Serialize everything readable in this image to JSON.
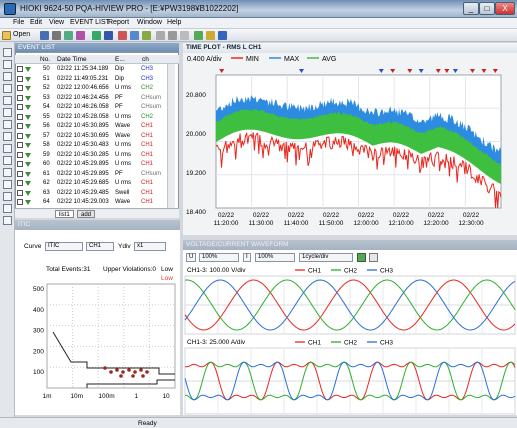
{
  "window": {
    "title": "HIOKI 9624-50 PQA-HIVIEW PRO - [E:¥PW3198¥B1022202]",
    "minimize": "_",
    "maximize": "□",
    "close": "X"
  },
  "menu": [
    "File",
    "Edit",
    "View",
    "EVENT LIST",
    "Report",
    "Window",
    "Help"
  ],
  "toolbar": {
    "open_label": "Open"
  },
  "event_list": {
    "title": "EVENT LIST",
    "columns": [
      "No.",
      "Date Time",
      "E...",
      "ch"
    ],
    "rows": [
      {
        "no": "50",
        "time": "02/22 11:25:34.189",
        "event": "Dip",
        "ch": "CH3",
        "ch_color": "#2030c0"
      },
      {
        "no": "51",
        "time": "02/22 11:49:05.231",
        "event": "Dip",
        "ch": "CH3",
        "ch_color": "#2030c0"
      },
      {
        "no": "52",
        "time": "02/22 12:00:46.656",
        "event": "U rms",
        "ch": "CH2",
        "ch_color": "#2a8f2a"
      },
      {
        "no": "53",
        "time": "02/22 10:46:24.456",
        "event": "PF",
        "ch": "CHsum",
        "ch_color": "#707070"
      },
      {
        "no": "54",
        "time": "02/22 10:46:26.058",
        "event": "PF",
        "ch": "CHsum",
        "ch_color": "#707070"
      },
      {
        "no": "55",
        "time": "02/22 10:45:28.058",
        "event": "U rms",
        "ch": "CH2",
        "ch_color": "#2a8f2a"
      },
      {
        "no": "56",
        "time": "02/22 10:45:30.895",
        "event": "Wave",
        "ch": "CH1",
        "ch_color": "#d02020"
      },
      {
        "no": "57",
        "time": "02/22 10:45:30.695",
        "event": "Wave",
        "ch": "CH1",
        "ch_color": "#d02020"
      },
      {
        "no": "58",
        "time": "02/22 10:45:30.483",
        "event": "U rms",
        "ch": "CH1",
        "ch_color": "#d02020"
      },
      {
        "no": "59",
        "time": "02/22 10:45:30.285",
        "event": "U rms",
        "ch": "CH1",
        "ch_color": "#d02020"
      },
      {
        "no": "60",
        "time": "02/22 10:45:29.895",
        "event": "U rms",
        "ch": "CH1",
        "ch_color": "#d02020"
      },
      {
        "no": "61",
        "time": "02/22 10:45:29.895",
        "event": "PF",
        "ch": "CHsum",
        "ch_color": "#707070"
      },
      {
        "no": "62",
        "time": "02/22 10:45:29.685",
        "event": "U rms",
        "ch": "CH1",
        "ch_color": "#d02020"
      },
      {
        "no": "63",
        "time": "02/22 10:45:29.485",
        "event": "Swell",
        "ch": "CH1",
        "ch_color": "#d02020"
      },
      {
        "no": "64",
        "time": "02/22 10:45:29.003",
        "event": "Wave",
        "ch": "CH1",
        "ch_color": "#d02020"
      }
    ],
    "tabs": [
      "list1",
      "add"
    ]
  },
  "time_plot": {
    "title": "TIME PLOT - RMS  L CH1",
    "scale_label": "0.400 A/div",
    "legend": [
      {
        "name": "MIN",
        "color": "#e8281e"
      },
      {
        "name": "MAX",
        "color": "#2d8be0"
      },
      {
        "name": "AVG",
        "color": "#3fbf3f"
      }
    ],
    "y_ticks": [
      "20.800",
      "20.000",
      "19.200",
      "18.400"
    ],
    "x_ticks": [
      [
        "02/22",
        "11:20:00"
      ],
      [
        "02/22",
        "11:30:00"
      ],
      [
        "02/22",
        "11:40:00"
      ],
      [
        "02/22",
        "11:50:00"
      ],
      [
        "02/22",
        "12:00:00"
      ],
      [
        "02/22",
        "12:10:00"
      ],
      [
        "02/22",
        "12:20:00"
      ],
      [
        "02/22",
        "12:30:00"
      ]
    ]
  },
  "itic": {
    "title": "ITIC",
    "curve_label": "Curve",
    "curve_value": "ITIC",
    "ch_value": "CH1",
    "ydiv_label": "Ydiv",
    "ydiv_value": "x1",
    "total_events": "Total Events:31",
    "upper_violations": "Upper Violations:0",
    "lower_label": "Low",
    "lower_label2": "Low",
    "y_ticks": [
      "500",
      "400",
      "300",
      "200",
      "100"
    ],
    "x_ticks": [
      "1m",
      "10m",
      "100m",
      "1",
      "10"
    ]
  },
  "waveform": {
    "title": "VOLTAGE/CURRENT WAVEFORM",
    "u_button": "U",
    "zoom1": "100%",
    "i_button": "I",
    "zoom2": "100%",
    "cycle": "1cycle/div",
    "voltage_scale": "CH1-3: 100.00 V/div",
    "current_scale": "CH1-3: 25.000 A/div",
    "channels": [
      {
        "name": "CH1",
        "color": "#e8281e"
      },
      {
        "name": "CH2",
        "color": "#2fae2f"
      },
      {
        "name": "CH3",
        "color": "#2a6fd6"
      }
    ]
  },
  "status": {
    "text": "Ready"
  }
}
